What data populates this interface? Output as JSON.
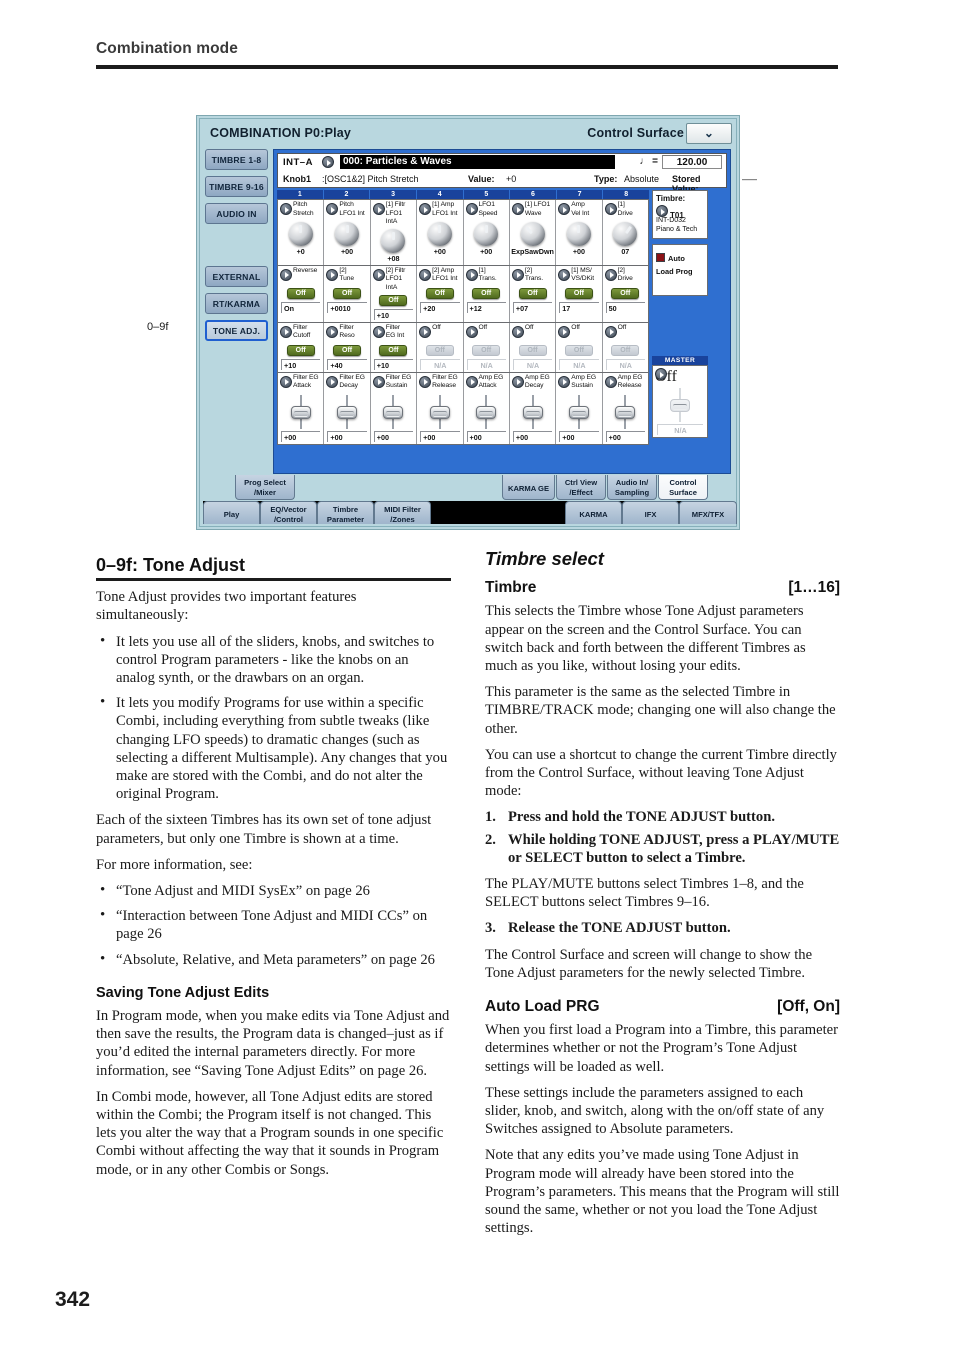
{
  "page": {
    "running_head": "Combination mode",
    "page_number": "342"
  },
  "figure": {
    "callout": "0–9f",
    "title_left": "COMBINATION P0:Play",
    "title_right": "Control Surface",
    "menu_icon": "⌄",
    "side_buttons": [
      {
        "label": "TIMBRE 1-8",
        "selected": false
      },
      {
        "label": "TIMBRE 9-16",
        "selected": false
      },
      {
        "label": "AUDIO IN",
        "selected": false
      },
      {
        "label": "EXTERNAL",
        "selected": false
      },
      {
        "label": "RT/KARMA",
        "selected": false
      },
      {
        "label": "TONE ADJ.",
        "selected": true
      }
    ],
    "info": {
      "bank": "INT–A",
      "program": "000: Particles & Waves",
      "tempo_note": "♩ =",
      "tempo": "120.00",
      "knob_label": "Knob1",
      "knob_param": ":[OSC1&2] Pitch Stretch",
      "value_label": "Value:",
      "value": "+0",
      "type_label": "Type:",
      "type": "Absolute",
      "stored_label": "Stored Value:",
      "stored": "–––"
    },
    "column_numbers": [
      "1",
      "2",
      "3",
      "4",
      "5",
      "6",
      "7",
      "8"
    ],
    "row_knobs": {
      "kind": "knob",
      "cells": [
        {
          "caption": [
            "Pitch",
            "Stretch"
          ],
          "value": "+0",
          "rot": ""
        },
        {
          "caption": [
            "Pitch",
            "LFO1 Int"
          ],
          "value": "+00",
          "rot": ""
        },
        {
          "caption": [
            "[1] Filtr",
            "LFO1 IntA"
          ],
          "value": "+08",
          "rot": ""
        },
        {
          "caption": [
            "[1] Amp",
            "LFO1 Int"
          ],
          "value": "+00",
          "rot": ""
        },
        {
          "caption": [
            "LFO1",
            "Speed"
          ],
          "value": "+00",
          "rot": ""
        },
        {
          "caption": [
            "[1] LFO1",
            "Wave"
          ],
          "value": "ExpSawDwn",
          "rot": "r2"
        },
        {
          "caption": [
            "Amp",
            "Vel Int"
          ],
          "value": "+00",
          "rot": ""
        },
        {
          "caption": [
            "[1]",
            "Drive"
          ],
          "value": "07",
          "rot": "r3"
        }
      ]
    },
    "row_switches_a": {
      "kind": "switch",
      "cells": [
        {
          "caption": [
            "Reverse",
            ""
          ],
          "sw": "Off",
          "value": "On",
          "dim": false
        },
        {
          "caption": [
            "[2]",
            "Tune"
          ],
          "sw": "Off",
          "value": "+0010",
          "dim": false
        },
        {
          "caption": [
            "[2] Filtr",
            "LFO1 IntA"
          ],
          "sw": "Off",
          "value": "+10",
          "dim": false
        },
        {
          "caption": [
            "[2] Amp",
            "LFO1 Int"
          ],
          "sw": "Off",
          "value": "+20",
          "dim": false
        },
        {
          "caption": [
            "[1]",
            "Trans."
          ],
          "sw": "Off",
          "value": "+12",
          "dim": false
        },
        {
          "caption": [
            "[2]",
            "Trans."
          ],
          "sw": "Off",
          "value": "+07",
          "dim": false
        },
        {
          "caption": [
            "[1] MS/",
            "VS/DKit"
          ],
          "sw": "Off",
          "value": "17",
          "dim": false
        },
        {
          "caption": [
            "[2]",
            "Drive"
          ],
          "sw": "Off",
          "value": "50",
          "dim": false
        }
      ]
    },
    "row_switches_b": {
      "kind": "switch",
      "cells": [
        {
          "caption": [
            "Filter",
            "Cutoff"
          ],
          "sw": "Off",
          "value": "+10",
          "dim": false
        },
        {
          "caption": [
            "Filter",
            "Reso"
          ],
          "sw": "Off",
          "value": "+40",
          "dim": false
        },
        {
          "caption": [
            "Filter",
            "EG Int"
          ],
          "sw": "Off",
          "value": "+10",
          "dim": false
        },
        {
          "caption": [
            "Off",
            ""
          ],
          "sw": "Off",
          "value": "N/A",
          "dim": true
        },
        {
          "caption": [
            "Off",
            ""
          ],
          "sw": "Off",
          "value": "N/A",
          "dim": true
        },
        {
          "caption": [
            "Off",
            ""
          ],
          "sw": "Off",
          "value": "N/A",
          "dim": true
        },
        {
          "caption": [
            "Off",
            ""
          ],
          "sw": "Off",
          "value": "N/A",
          "dim": true
        },
        {
          "caption": [
            "Off",
            ""
          ],
          "sw": "Off",
          "value": "N/A",
          "dim": true
        }
      ]
    },
    "row_sliders": {
      "kind": "slider",
      "cells": [
        {
          "caption": [
            "Filter EG",
            "Attack"
          ],
          "value": "+00",
          "dim": false
        },
        {
          "caption": [
            "Filter EG",
            "Decay"
          ],
          "value": "+00",
          "dim": false
        },
        {
          "caption": [
            "Filter EG",
            "Sustain"
          ],
          "value": "+00",
          "dim": false
        },
        {
          "caption": [
            "Filter EG",
            "Release"
          ],
          "value": "+00",
          "dim": false
        },
        {
          "caption": [
            "Amp EG",
            "Attack"
          ],
          "value": "+00",
          "dim": false
        },
        {
          "caption": [
            "Amp EG",
            "Decay"
          ],
          "value": "+00",
          "dim": false
        },
        {
          "caption": [
            "Amp EG",
            "Sustain"
          ],
          "value": "+00",
          "dim": false
        },
        {
          "caption": [
            "Amp EG",
            "Release"
          ],
          "value": "+00",
          "dim": false
        }
      ]
    },
    "right_panel": {
      "timbre_header": "Timbre:",
      "timbre_value": "T01",
      "timbre_prog_line1": "INT-D032",
      "timbre_prog_line2": "Piano & Tech",
      "auto_label": "Auto",
      "auto_label2": "Load Prog",
      "master_header": "MASTER",
      "master_value": "Off",
      "master_slider_value": "N/A"
    },
    "tabs_upper": [
      {
        "label": [
          "Prog Select",
          "/Mixer"
        ],
        "active": false
      },
      {
        "label": [
          "KARMA GE",
          ""
        ],
        "active": false
      },
      {
        "label": [
          "Ctrl View",
          "/Effect"
        ],
        "active": false
      },
      {
        "label": [
          "Audio In/",
          "Sampling"
        ],
        "active": false
      },
      {
        "label": [
          "Control",
          "Surface"
        ],
        "active": true
      }
    ],
    "tabs_lower": [
      {
        "label": [
          "Play",
          ""
        ]
      },
      {
        "label": [
          "EQ/Vector",
          "/Control"
        ]
      },
      {
        "label": [
          "Timbre",
          "Parameter"
        ]
      },
      {
        "label": [
          "MIDI Filter",
          "/Zones"
        ]
      },
      {
        "label": [
          "KARMA",
          ""
        ]
      },
      {
        "label": [
          "IFX",
          ""
        ]
      },
      {
        "label": [
          "MFX/TFX",
          ""
        ]
      }
    ]
  },
  "left_column": {
    "heading": "0–9f: Tone Adjust",
    "intro": "Tone Adjust provides two important features simultaneously:",
    "bullets": [
      "It lets you use all of the sliders, knobs, and switches to control Program parameters - like the knobs on an analog synth, or the drawbars on an organ.",
      "It lets you modify Programs for use within a specific Combi, including everything from subtle tweaks (like changing LFO speeds) to dramatic changes (such as selecting a different Multisample). Any changes that you make are stored with the Combi, and do not alter the original Program."
    ],
    "para_each": "Each of the sixteen Timbres has its own set of tone adjust parameters, but only one Timbre is shown at a time.",
    "para_more": "For more information, see:",
    "see_bullets": [
      "“Tone Adjust and MIDI SysEx” on page 26",
      "“Interaction between Tone Adjust and MIDI CCs” on page 26",
      "“Absolute, Relative, and Meta parameters” on page 26"
    ],
    "subheading": "Saving Tone Adjust Edits",
    "para_prog": "In Program mode, when you make edits via Tone Adjust and then save the results, the Program data is changed–just as if you’d edited the internal parameters directly. For more information, see “Saving Tone Adjust Edits” on page 26.",
    "para_combi": "In Combi mode, however, all Tone Adjust edits are stored within the Combi; the Program itself is not changed. This lets you alter the way that a Program sounds in one specific Combi without affecting the way that it sounds in Program mode, or in any other Combis or Songs."
  },
  "right_column": {
    "heading": "Timbre select",
    "param1_name": "Timbre",
    "param1_range": "[1…16]",
    "p1_a": "This selects the Timbre whose Tone Adjust parameters appear on the screen and the Control Surface. You can switch back and forth between the different Timbres as much as you like, without losing your edits.",
    "p1_b": "This parameter is the same as the selected Timbre in TIMBRE/TRACK mode; changing one will also change the other.",
    "p1_c": "You can use a shortcut to change the current Timbre directly from the Control Surface, without leaving Tone Adjust mode:",
    "steps": [
      "Press and hold the TONE ADJUST button.",
      "While holding TONE ADJUST, press a PLAY/MUTE or SELECT button to select a Timbre.",
      "Release the TONE ADJUST button."
    ],
    "after_step2": "The PLAY/MUTE buttons select Timbres 1–8, and the SELECT buttons select Timbres 9–16.",
    "after_step3": "The Control Surface and screen will change to show the Tone Adjust parameters for the newly selected Timbre.",
    "param2_name": "Auto Load PRG",
    "param2_range": "[Off, On]",
    "p2_a": "When you first load a Program into a Timbre, this parameter determines whether or not the Program’s Tone Adjust settings will be loaded as well.",
    "p2_b": "These settings include the parameters assigned to each slider, knob, and switch, along with the on/off state of any Switches assigned to Absolute parameters.",
    "p2_c": "Note that any edits you’ve made using Tone Adjust in Program mode will already have been stored into the Program’s parameters. This means that the Program will still sound the same, whether or not you load the Tone Adjust settings."
  }
}
